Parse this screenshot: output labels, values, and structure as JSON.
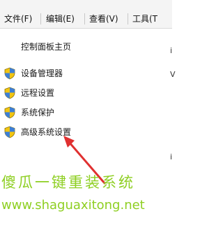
{
  "menubar": {
    "items": [
      {
        "label": "文件(F)"
      },
      {
        "label": "编辑(E)"
      },
      {
        "label": "查看(V)"
      },
      {
        "label": "工具(T"
      }
    ]
  },
  "sidebar": {
    "home_label": "控制面板主页",
    "links": [
      {
        "label": "设备管理器",
        "icon": "shield-icon"
      },
      {
        "label": "远程设置",
        "icon": "shield-icon"
      },
      {
        "label": "系统保护",
        "icon": "shield-icon"
      },
      {
        "label": "高级系统设置",
        "icon": "shield-icon"
      }
    ]
  },
  "right_pane": {
    "edge_chars": [
      "i",
      "V",
      "i"
    ]
  },
  "annotation": {
    "arrow_color": "#e03030"
  },
  "watermark": {
    "title": "傻瓜一键重装系统",
    "url": "www.shaguaxitong.net",
    "color": "#8ecf22"
  }
}
